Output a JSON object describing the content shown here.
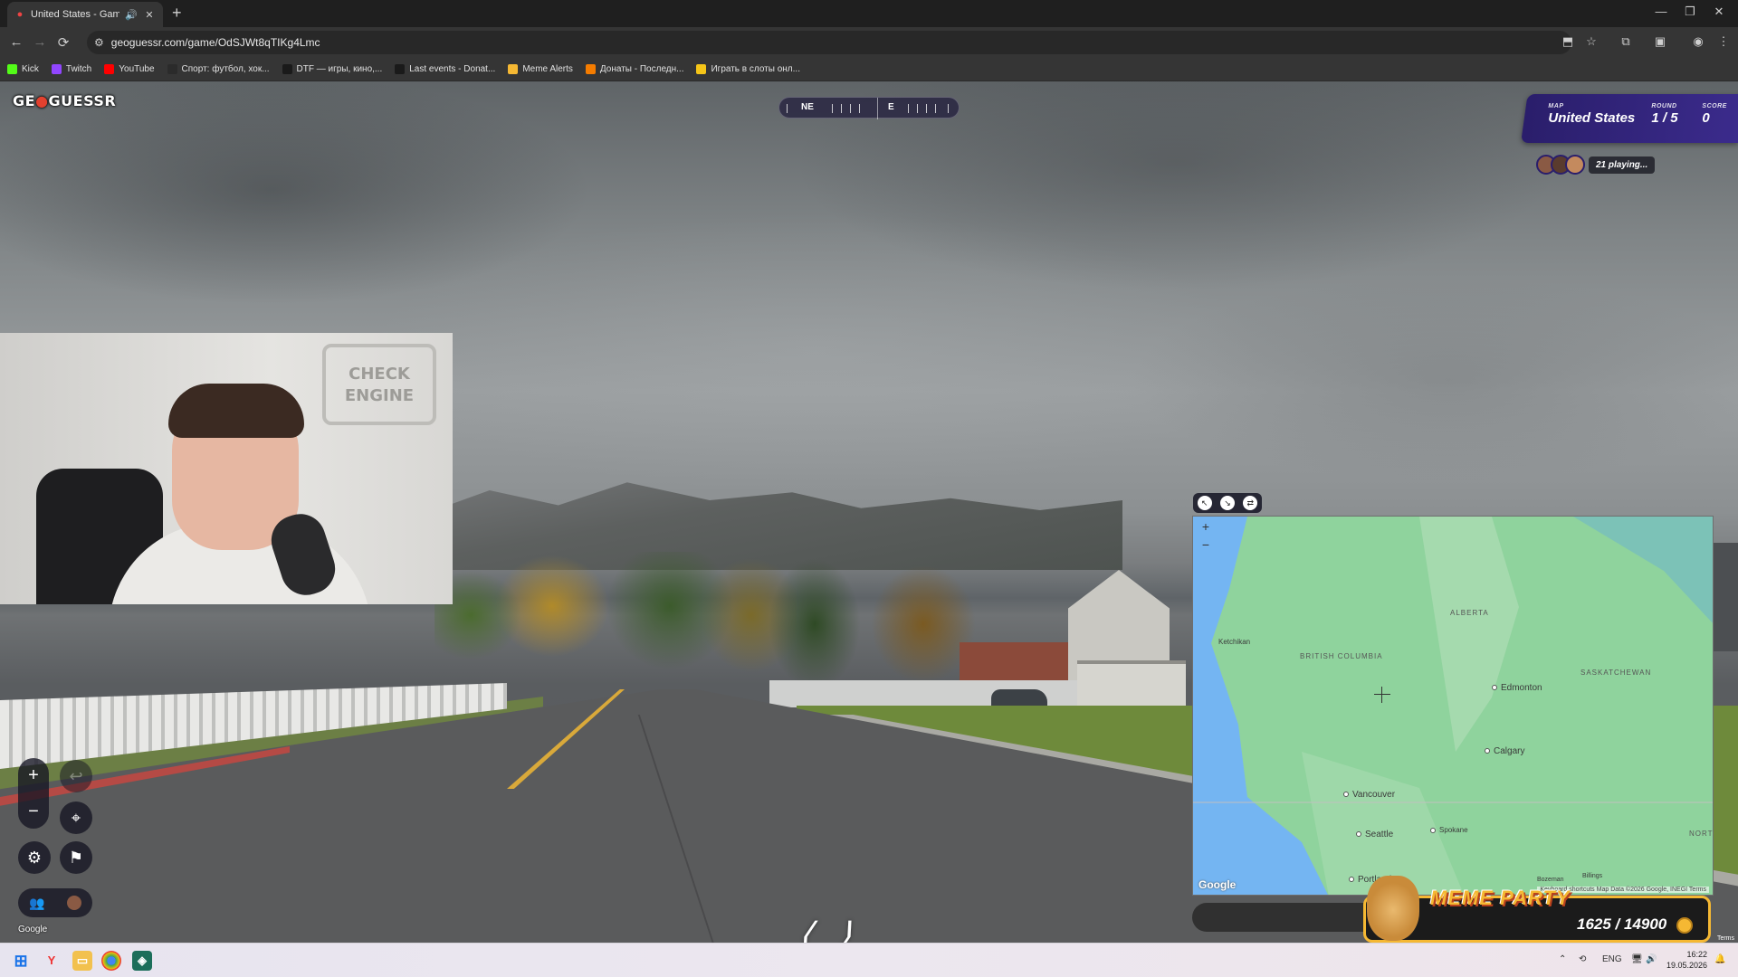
{
  "browser": {
    "tab": {
      "title": "United States - Game - Ge",
      "favicon": "geoguessr-pin-icon"
    },
    "url": "geoguessr.com/game/OdSJWt8qTIKg4Lmc",
    "bookmarks": [
      {
        "label": "Kick",
        "color": "#53fc18"
      },
      {
        "label": "Twitch",
        "color": "#9146ff"
      },
      {
        "label": "YouTube",
        "color": "#ff0000"
      },
      {
        "label": "Спорт: футбол, хок...",
        "color": "#2b2b2b"
      },
      {
        "label": "DTF — игры, кино,...",
        "color": "#1a1a1a"
      },
      {
        "label": "Last events - Donat...",
        "color": "#1a1a1a"
      },
      {
        "label": "Meme Alerts",
        "color": "#f5b833"
      },
      {
        "label": "Донаты - Последн...",
        "color": "#f57c00"
      },
      {
        "label": "Играть в слоты онл...",
        "color": "#f5c518"
      }
    ]
  },
  "game": {
    "logo": {
      "part1": "GE",
      "pin": "●",
      "part2": "GUESSR"
    },
    "compass": {
      "left_label": "NE",
      "right_label": "E"
    },
    "status": {
      "map_caption": "MAP",
      "map_value": "United States",
      "round_caption": "ROUND",
      "round_value": "1 / 5",
      "score_caption": "SCORE",
      "score_value": "0"
    },
    "playing": "21 playing...",
    "google_label": "Google",
    "webcam_sign": "CHECK ENGINE"
  },
  "guess_map": {
    "regions": [
      "ALBERTA",
      "BRITISH COLUMBIA",
      "SASKATCHEWAN",
      "NORTH DAKOTA"
    ],
    "cities": [
      "Edmonton",
      "Calgary",
      "Vancouver",
      "Seattle",
      "Spokane",
      "Portland",
      "Ketchikan",
      "Bozeman",
      "Billings"
    ],
    "google": "Google",
    "attribution": "Keyboard shortcuts   Map Data ©2026 Google, INEGI   Terms"
  },
  "meme_party": {
    "title": "MEME PARTY",
    "score": "1625 / 14900"
  },
  "terms": "Terms",
  "taskbar": {
    "lang": "ENG",
    "time": "16:22",
    "date": "19.05.2026"
  }
}
